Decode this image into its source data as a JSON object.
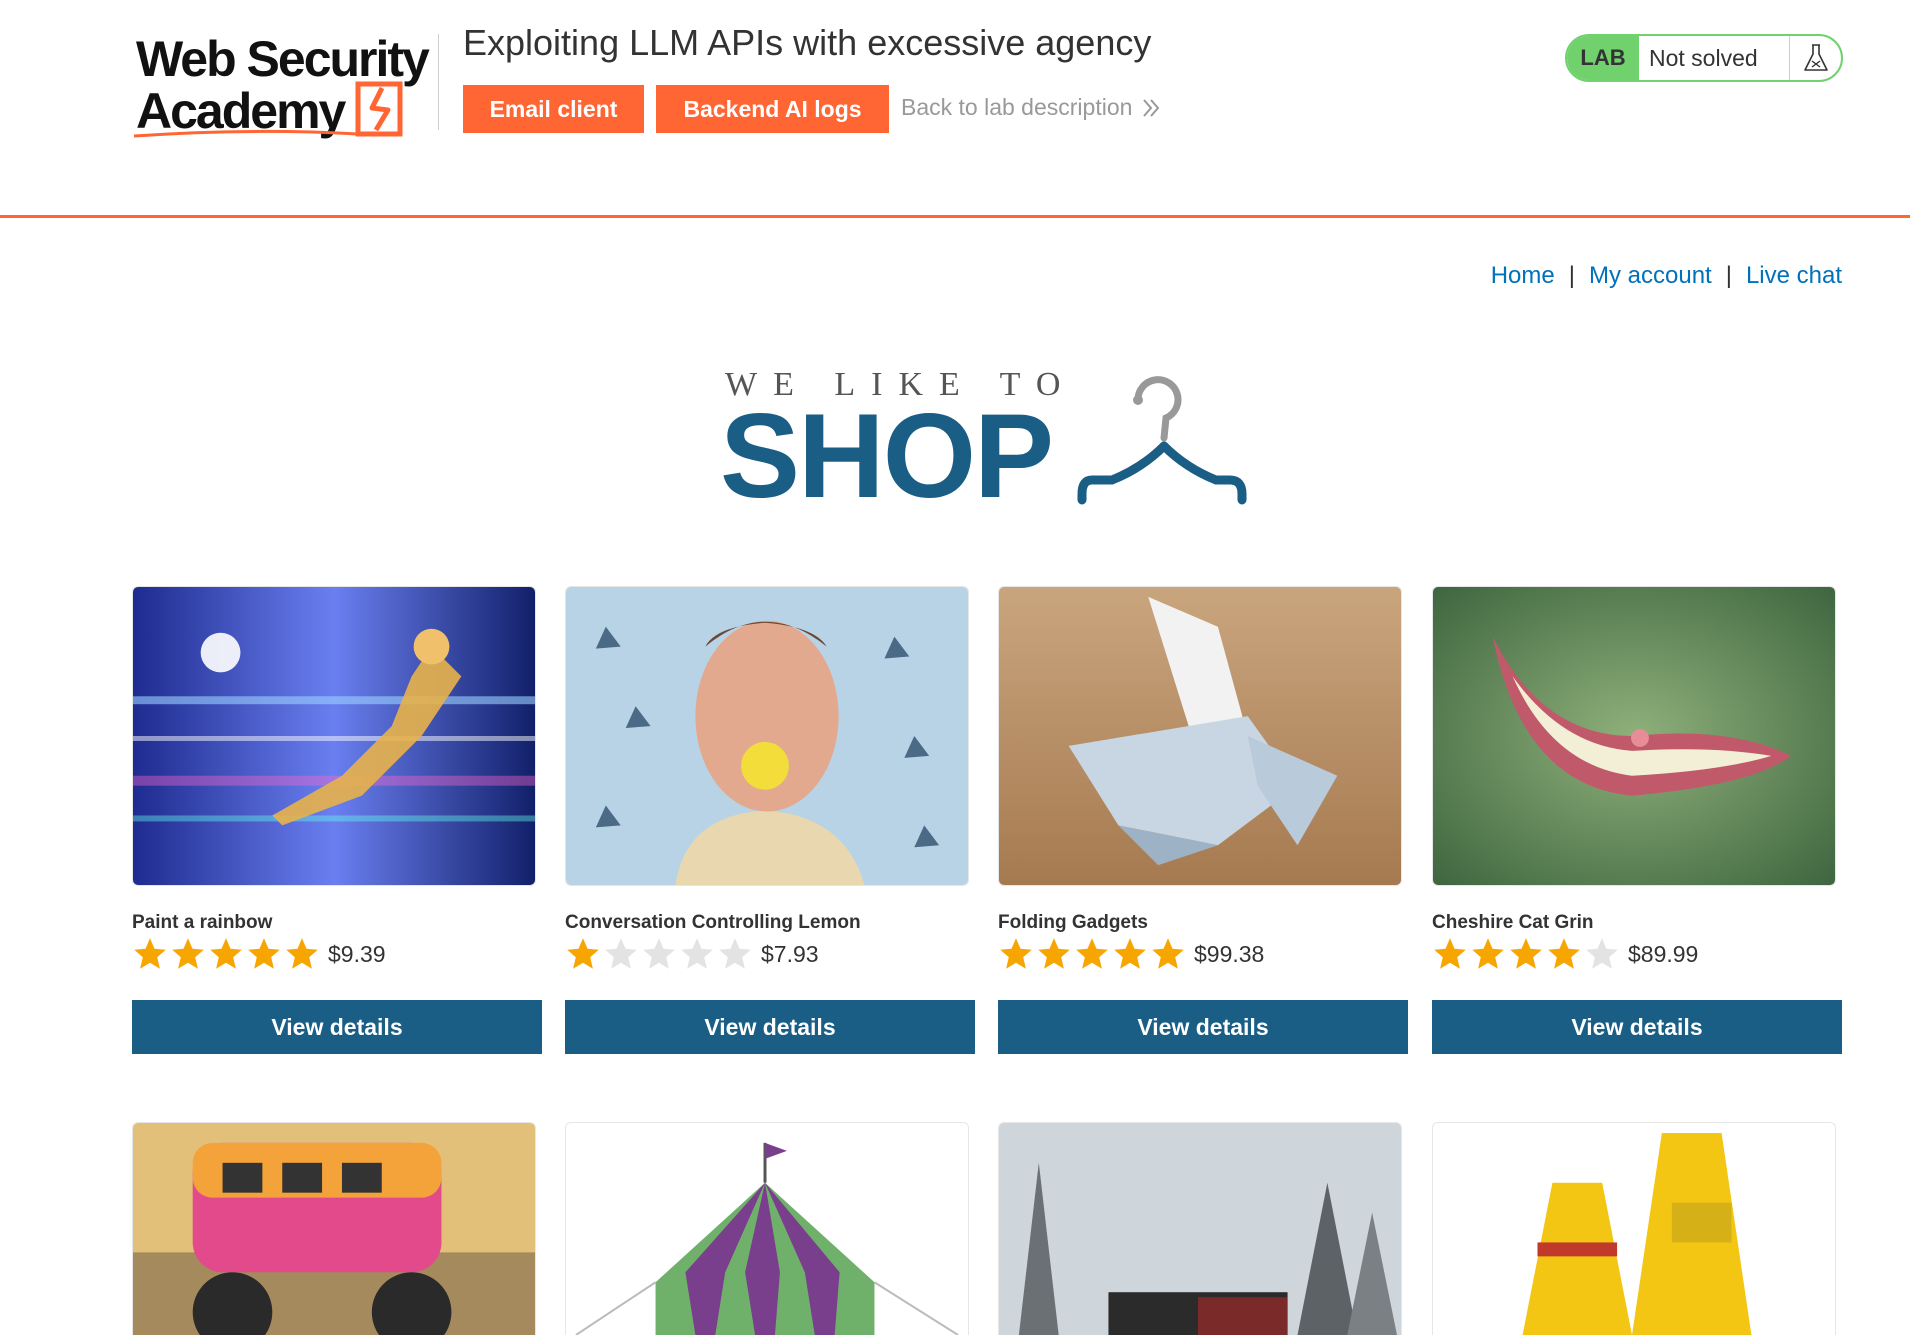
{
  "academy": {
    "logo_line1": "Web Security",
    "logo_line2": "Academy",
    "lab_title": "Exploiting LLM APIs with excessive agency",
    "email_client_label": "Email client",
    "backend_ai_logs_label": "Backend AI logs",
    "back_link_label": "Back to lab description",
    "lab_badge": "LAB",
    "lab_status": "Not solved",
    "accent_color": "#ff6633",
    "status_color": "#70d16d"
  },
  "nav": {
    "home": "Home",
    "my_account": "My account",
    "live_chat": "Live chat",
    "separator": "|",
    "link_color": "#0071bc"
  },
  "hero": {
    "tagline": "WE LIKE TO",
    "title": "SHOP",
    "brand_color": "#1a5e85"
  },
  "products": [
    {
      "name": "Paint a rainbow",
      "rating": 5,
      "price": "$9.39",
      "button": "View details",
      "image_icon": "superhero-image"
    },
    {
      "name": "Conversation Controlling Lemon",
      "rating": 1,
      "price": "$7.93",
      "button": "View details",
      "image_icon": "lemon-face-image"
    },
    {
      "name": "Folding Gadgets",
      "rating": 5,
      "price": "$99.38",
      "button": "View details",
      "image_icon": "origami-image"
    },
    {
      "name": "Cheshire Cat Grin",
      "rating": 4,
      "price": "$89.99",
      "button": "View details",
      "image_icon": "cat-grin-image"
    },
    {
      "image_icon": "monster-van-image"
    },
    {
      "image_icon": "circus-tent-image"
    },
    {
      "image_icon": "snowy-train-image"
    },
    {
      "image_icon": "caution-sign-image"
    }
  ]
}
